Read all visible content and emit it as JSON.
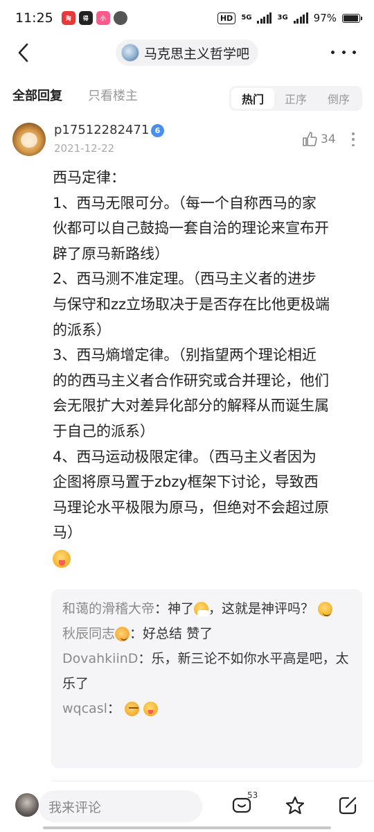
{
  "status_bar": {
    "time": "11:25",
    "hd_badge": "HD",
    "sim1_network": "5G",
    "sim2_network": "3G",
    "battery_text": "97%",
    "battery_level": 0.97
  },
  "nav": {
    "forum_name": "马克思主义哲学吧"
  },
  "filters": {
    "all_replies": "全部回复",
    "host_only": "只看楼主",
    "sort_options": [
      "热门",
      "正序",
      "倒序"
    ],
    "active_sort": "热门"
  },
  "post": {
    "username": "p17512282471",
    "badge_text": "6",
    "date": "2021-12-22",
    "like_count": "34",
    "content_lines": [
      "西马定律：",
      "1、西马无限可分。（每一个自称西马的家",
      "伙都可以自己鼓捣一套自洽的理论来宣布开",
      "辟了原马新路线）",
      "2、西马测不准定理。（西马主义者的进步",
      "与保守和zz立场取决于是否存在比他更极端",
      "的派系）",
      "3、西马熵增定律。（别指望两个理论相近",
      "的的西马主义者合作研究或合并理论，他们",
      "会无限扩大对差异化部分的解释从而诞生属",
      "于自己的派系）",
      "4、西马运动极限定律。（西马主义者因为",
      "企图将原马置于zbzy框架下讨论，导致西",
      "马理论水平极限为原马，但绝对不会超过原",
      "马）"
    ],
    "content_emoji": "yummy-face-emoji"
  },
  "replies": [
    {
      "name": "和蔼的滑稽大帝",
      "sep": "：",
      "text_a": "神了",
      "emoji_a": "sneeze-emoji",
      "text_b": "，这就是神评吗？",
      "emoji_b": "smile-emoji"
    },
    {
      "name": "秋辰同志",
      "name_emoji": "cat-emoji",
      "sep": "：",
      "text": "好总结 赞了"
    },
    {
      "name": "DovahkiinD",
      "sep": "：",
      "text": "乐，新三论不如你水平高是吧，太乐了"
    },
    {
      "name": "wqcasl",
      "sep": "：",
      "emojis": [
        "angry-emoji",
        "yummy-face-emoji"
      ]
    }
  ],
  "bottom_bar": {
    "comment_placeholder": "我来评论",
    "reply_count": "53"
  }
}
